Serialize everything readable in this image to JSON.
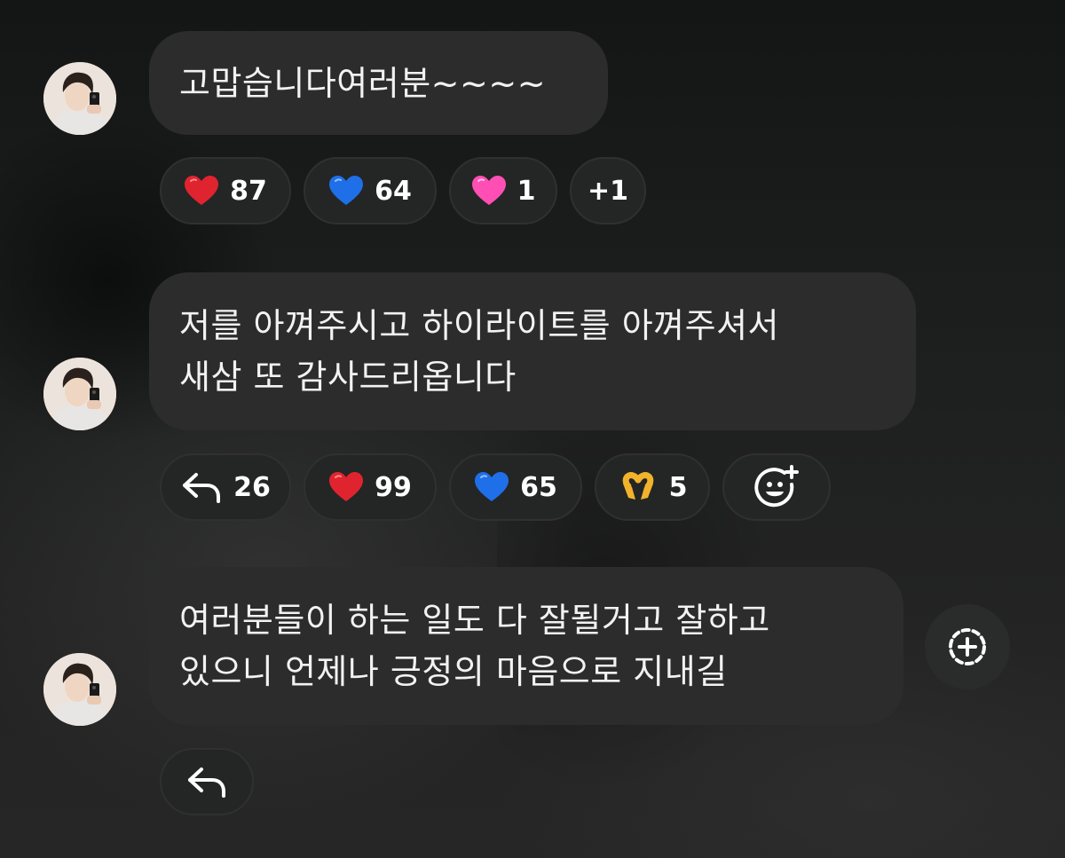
{
  "messages": [
    {
      "text_lines": [
        "고맙습니다여러분~~~~"
      ],
      "reactions": [
        {
          "icon": "red-heart-icon",
          "emoji": "❤️",
          "count": "87"
        },
        {
          "icon": "blue-heart-icon",
          "emoji": "💙",
          "count": "64"
        },
        {
          "icon": "pink-heart-icon",
          "emoji": "💗",
          "count": "1"
        },
        {
          "label": "+1"
        }
      ]
    },
    {
      "text_lines": [
        "저를 아껴주시고 하이라이트를 아껴주셔서",
        "새삼 또 감사드리옵니다"
      ],
      "reply_count": "26",
      "reactions": [
        {
          "icon": "red-heart-icon",
          "emoji": "❤️",
          "count": "99"
        },
        {
          "icon": "blue-heart-icon",
          "emoji": "💙",
          "count": "65"
        },
        {
          "icon": "heart-hands-icon",
          "emoji": "🫶",
          "count": "5"
        }
      ]
    },
    {
      "text_lines": [
        "여러분들이 하는 일도 다 잘될거고 잘하고",
        "있으니 언제나 긍정의 마음으로 지내길"
      ]
    }
  ],
  "colors": {
    "bubble": "#2c2c2c",
    "pill": "#242525",
    "red_heart": "#e0242f",
    "blue_heart": "#1f6fe8",
    "pink_heart": "#ff4fb5",
    "hands": "#f2b22c"
  }
}
